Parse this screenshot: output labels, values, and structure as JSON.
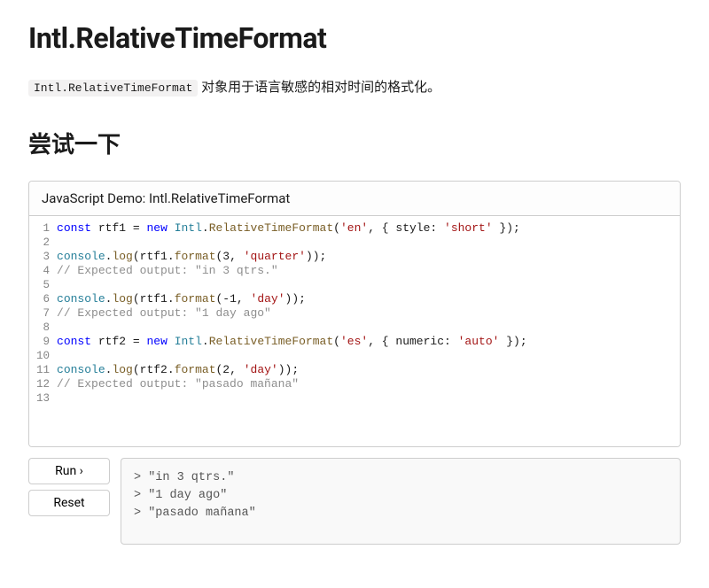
{
  "title": "Intl.RelativeTimeFormat",
  "intro_code": "Intl.RelativeTimeFormat",
  "intro_text": " 对象用于语言敏感的相对时间的格式化。",
  "try_heading": "尝试一下",
  "demo_title": "JavaScript Demo: Intl.RelativeTimeFormat",
  "code_line_count": 13,
  "code_plain": [
    "const rtf1 = new Intl.RelativeTimeFormat('en', { style: 'short' });",
    "",
    "console.log(rtf1.format(3, 'quarter'));",
    "// Expected output: \"in 3 qtrs.\"",
    "",
    "console.log(rtf1.format(-1, 'day'));",
    "// Expected output: \"1 day ago\"",
    "",
    "const rtf2 = new Intl.RelativeTimeFormat('es', { numeric: 'auto' });",
    "",
    "console.log(rtf2.format(2, 'day'));",
    "// Expected output: \"pasado mañana\"",
    ""
  ],
  "buttons": {
    "run": "Run ›",
    "reset": "Reset"
  },
  "output": [
    "> \"in 3 qtrs.\"",
    "> \"1 day ago\"",
    "> \"pasado mañana\""
  ]
}
